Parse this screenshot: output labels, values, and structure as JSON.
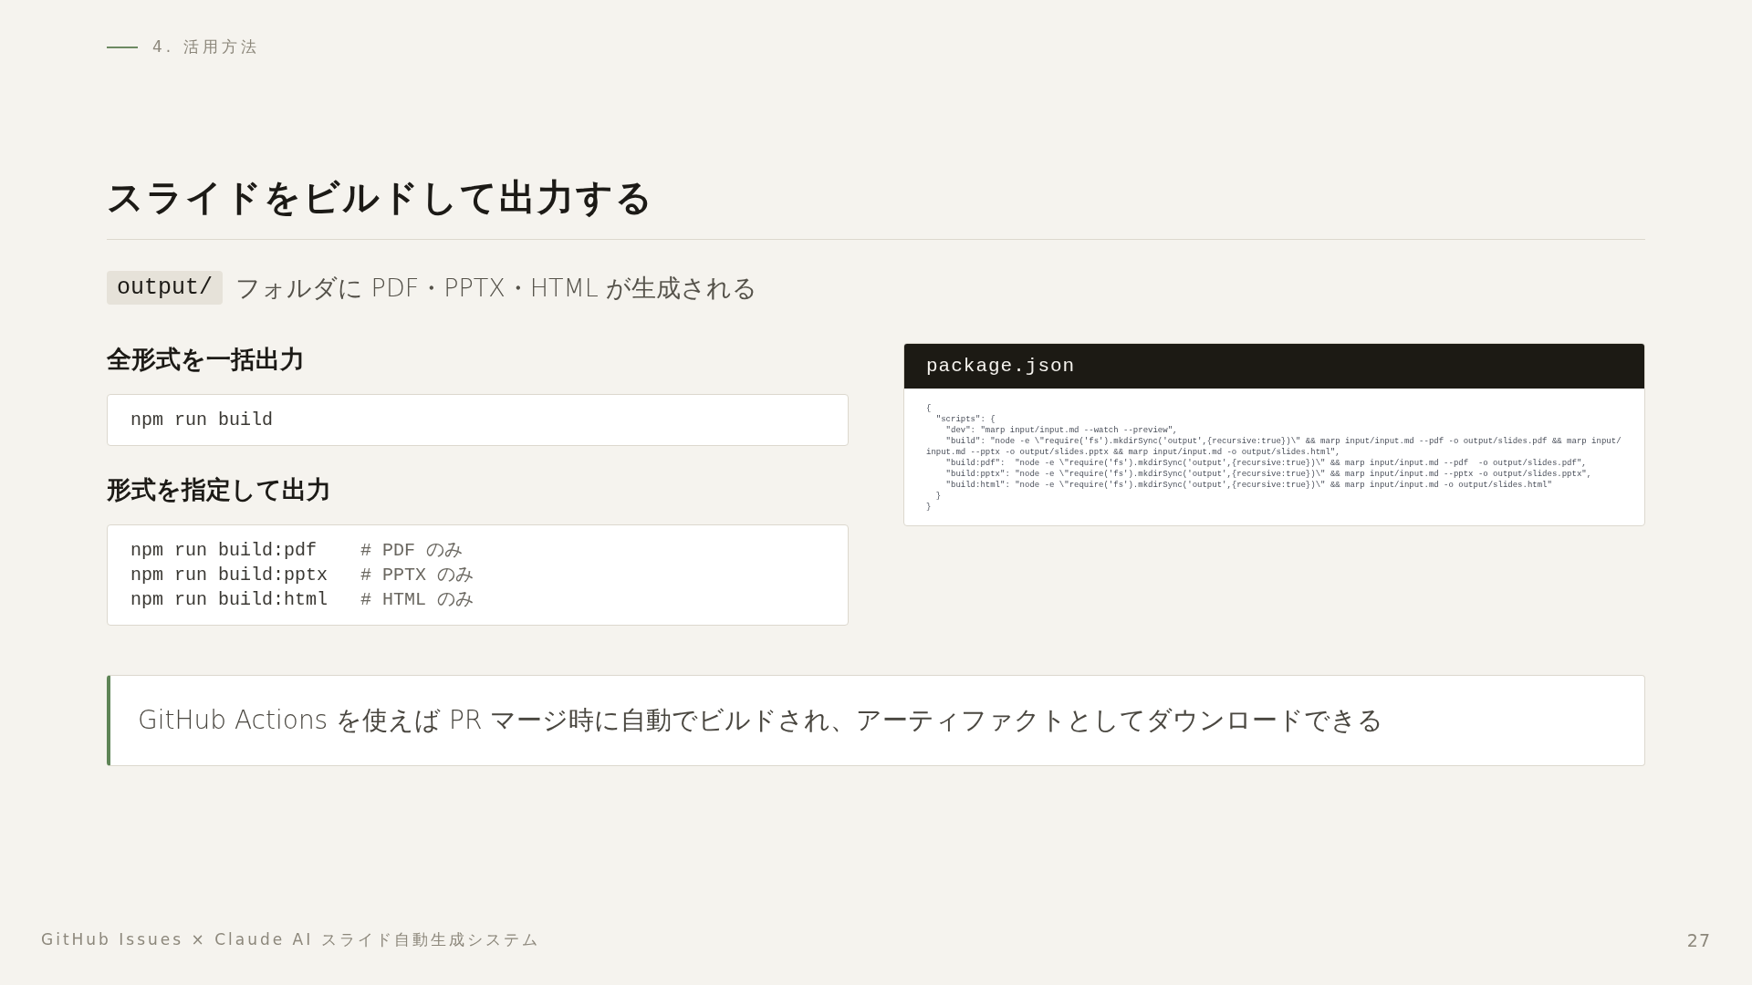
{
  "section_label": "4. 活用方法",
  "title": "スライドをビルドして出力する",
  "subtitle": {
    "code": "output/",
    "text": "フォルダに PDF・PPTX・HTML が生成される"
  },
  "blocks": [
    {
      "heading": "全形式を一括出力",
      "lines": [
        {
          "command": "npm run build"
        }
      ]
    },
    {
      "heading": "形式を指定して出力",
      "lines": [
        {
          "command": "npm run build:pdf    ",
          "comment": "# PDF のみ"
        },
        {
          "command": "npm run build:pptx   ",
          "comment": "# PPTX のみ"
        },
        {
          "command": "npm run build:html   ",
          "comment": "# HTML のみ"
        }
      ]
    }
  ],
  "code_panel": {
    "filename": "package.json",
    "lines": [
      "{",
      "  \"scripts\": {",
      "    \"dev\": \"marp input/input.md --watch --preview\",",
      "    \"build\": \"node -e \\\"require('fs').mkdirSync('output',{recursive:true})\\\" && marp input/input.md --pdf -o output/slides.pdf && marp input/input.md --pptx -o output/slides.pptx && marp input/input.md -o output/slides.html\",",
      "    \"build:pdf\":  \"node -e \\\"require('fs').mkdirSync('output',{recursive:true})\\\" && marp input/input.md --pdf  -o output/slides.pdf\",",
      "    \"build:pptx\": \"node -e \\\"require('fs').mkdirSync('output',{recursive:true})\\\" && marp input/input.md --pptx -o output/slides.pptx\",",
      "    \"build:html\": \"node -e \\\"require('fs').mkdirSync('output',{recursive:true})\\\" && marp input/input.md -o output/slides.html\"",
      "  }",
      "}"
    ]
  },
  "callout": "GitHub Actions を使えば PR マージ時に自動でビルドされ、アーティファクトとしてダウンロードできる",
  "footer": "GitHub Issues × Claude AI スライド自動生成システム",
  "page_number": "27"
}
